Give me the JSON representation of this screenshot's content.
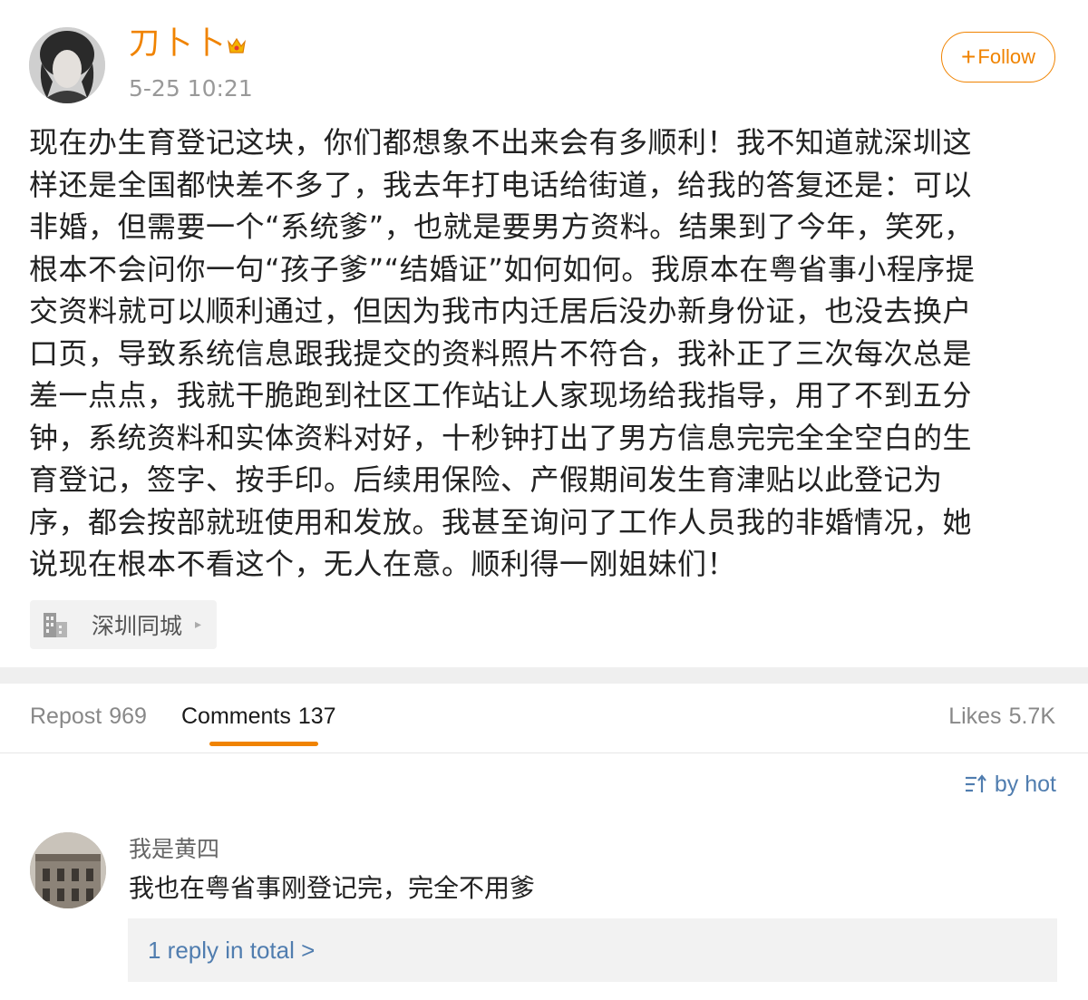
{
  "post": {
    "username": "刀卜卜",
    "timestamp": "5-25 10:21",
    "follow_label": "Follow",
    "follow_icon": "plus-icon",
    "badge_icon": "crown-icon",
    "body_lines": [
      "现在办生育登记这块，你们都想象不出来会有多顺利！我不知道就深圳这",
      "样还是全国都快差不多了，我去年打电话给街道，给我的答复还是：可以",
      "非婚，但需要一个“系统爹”，也就是要男方资料。结果到了今年，笑死，",
      "根本不会问你一句“孩子爹”“结婚证”如何如何。我原本在粤省事小程序提",
      "交资料就可以顺利通过，但因为我市内迁居后没办新身份证，也没去换户",
      "口页，导致系统信息跟我提交的资料照片不符合，我补正了三次每次总是",
      "差一点点，我就干脆跑到社区工作站让人家现场给我指导，用了不到五分",
      "钟，系统资料和实体资料对好，十秒钟打出了男方信息完完全全空白的生",
      "育登记，签字、按手印。后续用保险、产假期间发生育津贴以此登记为",
      "序，都会按部就班使用和发放。我甚至询问了工作人员我的非婚情况，她",
      "说现在根本不看这个，无人在意。顺利得一刚姐妹们！"
    ],
    "location": {
      "label": "深圳同城",
      "icon": "building-icon"
    }
  },
  "tabs": {
    "repost_label": "Repost",
    "repost_count": "969",
    "comments_label": "Comments",
    "comments_count": "137",
    "likes_label": "Likes",
    "likes_count": "5.7K"
  },
  "sort": {
    "label": "by hot",
    "icon": "sort-icon"
  },
  "comments": [
    {
      "username": "我是黄四",
      "text": "我也在粤省事刚登记完，完全不用爹",
      "reply_summary": "1 reply in total >"
    }
  ],
  "colors": {
    "accent": "#f08300",
    "link": "#507daf",
    "separator": "#efefef"
  }
}
